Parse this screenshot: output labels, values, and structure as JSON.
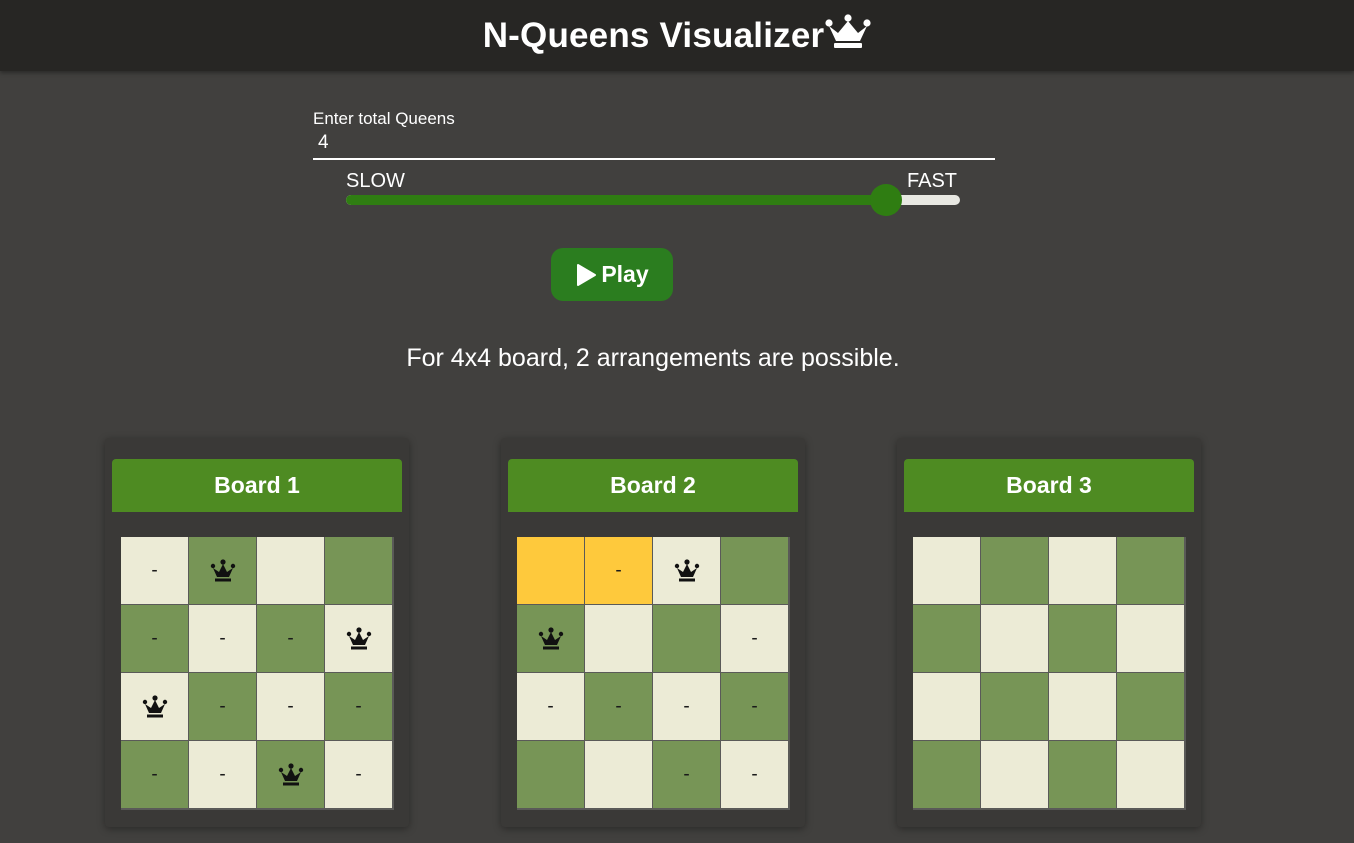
{
  "header": {
    "title": "N-Queens Visualizer",
    "crown_icon": "crown-icon"
  },
  "controls": {
    "input_label": "Enter total Queens",
    "queens_value": "4",
    "slow_label": "SLOW",
    "fast_label": "FAST",
    "speed_fraction": 0.88,
    "play_label": "Play",
    "play_icon": "play-icon"
  },
  "result": {
    "text": "For 4x4 board, 2 arrangements are possible."
  },
  "colors": {
    "light_square": "#ecebd6",
    "dark_square": "#779556",
    "highlight": "#fec93c",
    "accent_green": "#4e8b22",
    "button_green": "#2b7d1f"
  },
  "boards": [
    {
      "title": "Board 1",
      "cells": [
        [
          "-",
          "Q",
          "",
          ""
        ],
        [
          "-",
          "-",
          "-",
          "Q"
        ],
        [
          "Q",
          "-",
          "-",
          "-"
        ],
        [
          "-",
          "-",
          "Q",
          "-"
        ]
      ],
      "highlighted": []
    },
    {
      "title": "Board 2",
      "cells": [
        [
          "",
          "-",
          "Q",
          ""
        ],
        [
          "Q",
          "",
          "",
          "-"
        ],
        [
          "-",
          "-",
          "-",
          "-"
        ],
        [
          "",
          "",
          "-",
          "-"
        ]
      ],
      "highlighted": [
        [
          0,
          0
        ],
        [
          0,
          1
        ]
      ]
    },
    {
      "title": "Board 3",
      "cells": [
        [
          "",
          "",
          "",
          ""
        ],
        [
          "",
          "",
          "",
          ""
        ],
        [
          "",
          "",
          "",
          ""
        ],
        [
          "",
          "",
          "",
          ""
        ]
      ],
      "highlighted": []
    }
  ]
}
